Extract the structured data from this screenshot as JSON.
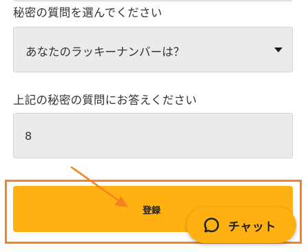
{
  "form": {
    "question_label": "秘密の質問を選んでください",
    "selected_question": "あなたのラッキーナンバーは？",
    "answer_label": "上記の秘密の質問にお答えください",
    "answer_value": "8",
    "submit_label": "登録"
  },
  "chat": {
    "label": "チャット",
    "icon": "chat-bubble-icon"
  },
  "annotation": {
    "color": "#f58220",
    "target": "submit-button"
  },
  "colors": {
    "button_yellow": "#feb111",
    "field_background": "#ebebeb",
    "text": "#333333"
  }
}
